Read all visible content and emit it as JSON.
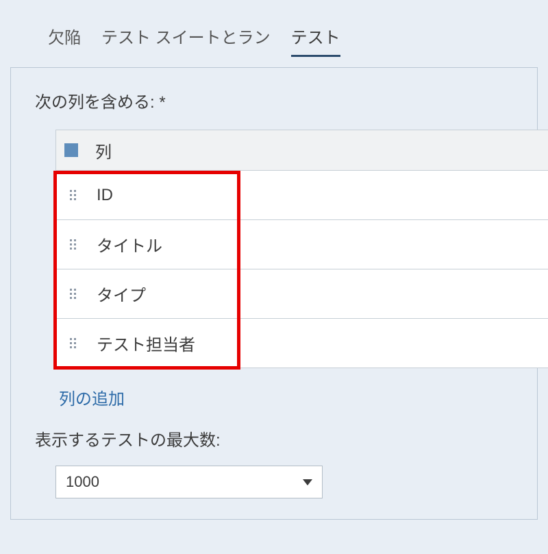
{
  "tabs": {
    "defects": "欠陥",
    "suites": "テスト スイートとラン",
    "tests": "テスト"
  },
  "columns": {
    "label": "次の列を含める: *",
    "header": "列",
    "items": {
      "0": "ID",
      "1": "タイトル",
      "2": "タイプ",
      "3": "テスト担当者"
    },
    "add": "列の追加"
  },
  "max": {
    "label": "表示するテストの最大数:",
    "value": "1000"
  }
}
